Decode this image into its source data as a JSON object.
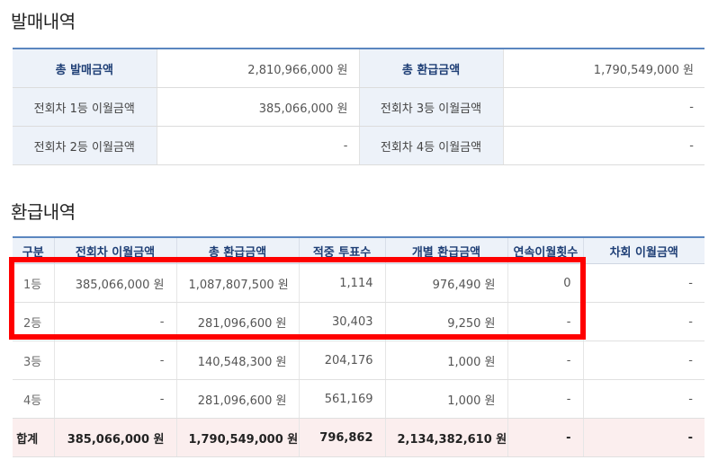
{
  "sales_section": {
    "title": "발매내역",
    "rows": [
      {
        "label1": "총 발매금액",
        "value1": "2,810,966,000 원",
        "label2": "총 환급금액",
        "value2": "1,790,549,000 원"
      },
      {
        "label1": "전회차 1등 이월금액",
        "value1": "385,066,000 원",
        "label2": "전회차 3등 이월금액",
        "value2": "-"
      },
      {
        "label1": "전회차 2등 이월금액",
        "value1": "-",
        "label2": "전회차 4등 이월금액",
        "value2": "-"
      }
    ]
  },
  "refund_section": {
    "title": "환급내역",
    "headers": [
      "구분",
      "전회차 이월금액",
      "총 환급금액",
      "적중 투표수",
      "개별 환급금액",
      "연속이월횟수",
      "차회 이월금액"
    ],
    "rows": [
      [
        "1등",
        "385,066,000 원",
        "1,087,807,500 원",
        "1,114",
        "976,490 원",
        "0",
        "-"
      ],
      [
        "2등",
        "-",
        "281,096,600 원",
        "30,403",
        "9,250 원",
        "-",
        "-"
      ],
      [
        "3등",
        "-",
        "140,548,300 원",
        "204,176",
        "1,000 원",
        "-",
        "-"
      ],
      [
        "4등",
        "-",
        "281,096,600 원",
        "561,169",
        "1,000 원",
        "-",
        "-"
      ]
    ],
    "total": [
      "합계",
      "385,066,000 원",
      "1,790,549,000 원",
      "796,862",
      "2,134,382,610 원",
      "-",
      "-"
    ]
  },
  "colors": {
    "header_bg": "#edf2f9",
    "header_text": "#1f3f76",
    "accent_border": "#5b86bf",
    "total_row_bg": "#fbeeee",
    "highlight_box": "#ff0000"
  }
}
